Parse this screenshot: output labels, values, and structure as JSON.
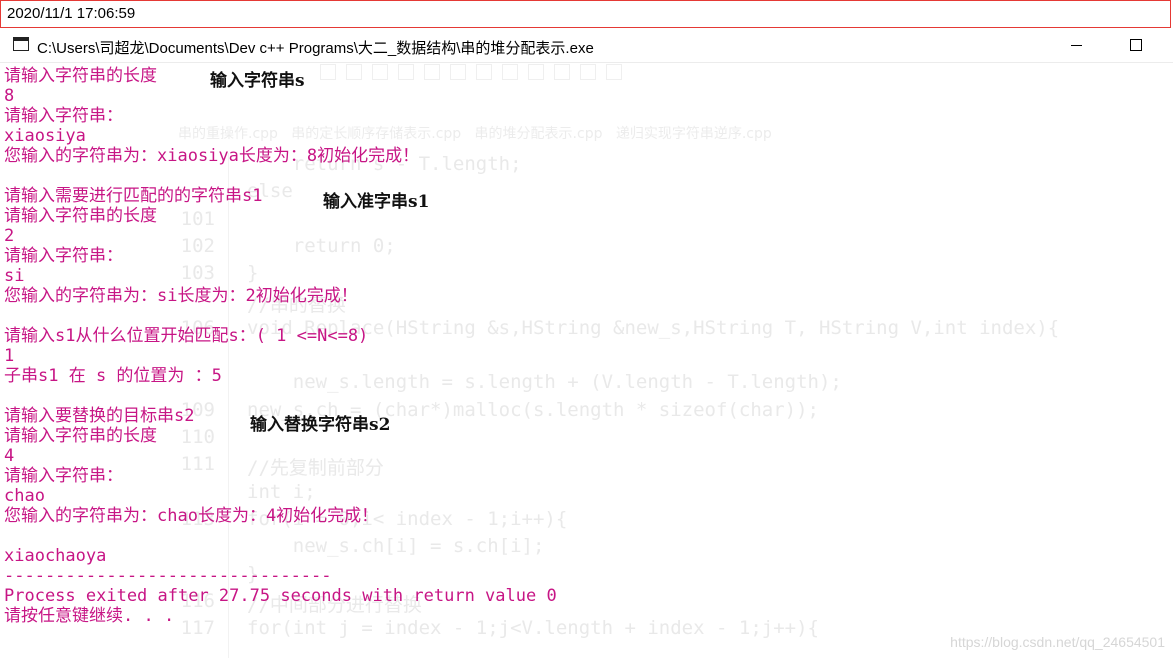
{
  "timestamp": "2020/11/1 17:06:59",
  "window": {
    "title": "C:\\Users\\司超龙\\Documents\\Dev c++ Programs\\大二_数据结构\\串的堆分配表示.exe"
  },
  "console": {
    "lines": [
      "请输入字符串的长度",
      "8",
      "请输入字符串：",
      "xiaosiya",
      "您输入的字符串为：xiaosiya长度为：8初始化完成！",
      "",
      "请输入需要进行匹配的的字符串s1",
      "请输入字符串的长度",
      "2",
      "请输入字符串：",
      "si",
      "您输入的字符串为：si长度为：2初始化完成！",
      "",
      "请输入s1从什么位置开始匹配s：( 1 <=N<=8)",
      "1",
      "子串s1 在 s 的位置为 ：5",
      "",
      "请输入要替换的目标串s2",
      "请输入字符串的长度",
      "4",
      "请输入字符串：",
      "chao",
      "您输入的字符串为：chao长度为：4初始化完成！",
      "",
      "xiaochaoya",
      "--------------------------------",
      "Process exited after 27.75 seconds with return value 0",
      "请按任意键继续. . ."
    ]
  },
  "annotations": {
    "a1": "输入字符串s",
    "a2": "输入准字串s1",
    "a3": "输入替换字符串s2"
  },
  "background_editor": {
    "tabs": "串的重操作.cpp   串的定长顺序存储表示.cpp   串的堆分配表示.cpp   递归实现字符串逆序.cpp",
    "lines": [
      {
        "num": "",
        "code": "    return s - T.length;"
      },
      {
        "num": "",
        "code": "else"
      },
      {
        "num": "101",
        "code": ""
      },
      {
        "num": "102",
        "code": "    return 0;"
      },
      {
        "num": "103",
        "code": "}"
      },
      {
        "num": "",
        "code": "//串的替换"
      },
      {
        "num": "106",
        "code": "void Replace(HString &s,HString &new_s,HString T, HString V,int index){"
      },
      {
        "num": "",
        "code": ""
      },
      {
        "num": "",
        "code": "    new_s.length = s.length + (V.length - T.length);"
      },
      {
        "num": "109",
        "code": "new_s.ch = (char*)malloc(s.length * sizeof(char));"
      },
      {
        "num": "110",
        "code": ""
      },
      {
        "num": "111",
        "code": "//先复制前部分"
      },
      {
        "num": "",
        "code": "int i;"
      },
      {
        "num": "113",
        "code": "for(i = 0;i< index - 1;i++){"
      },
      {
        "num": "",
        "code": "    new_s.ch[i] = s.ch[i];"
      },
      {
        "num": "",
        "code": "}"
      },
      {
        "num": "116",
        "code": "//中间部分进行替换"
      },
      {
        "num": "117",
        "code": "for(int j = index - 1;j<V.length + index - 1;j++){"
      }
    ]
  },
  "watermark": "https://blog.csdn.net/qq_24654501"
}
